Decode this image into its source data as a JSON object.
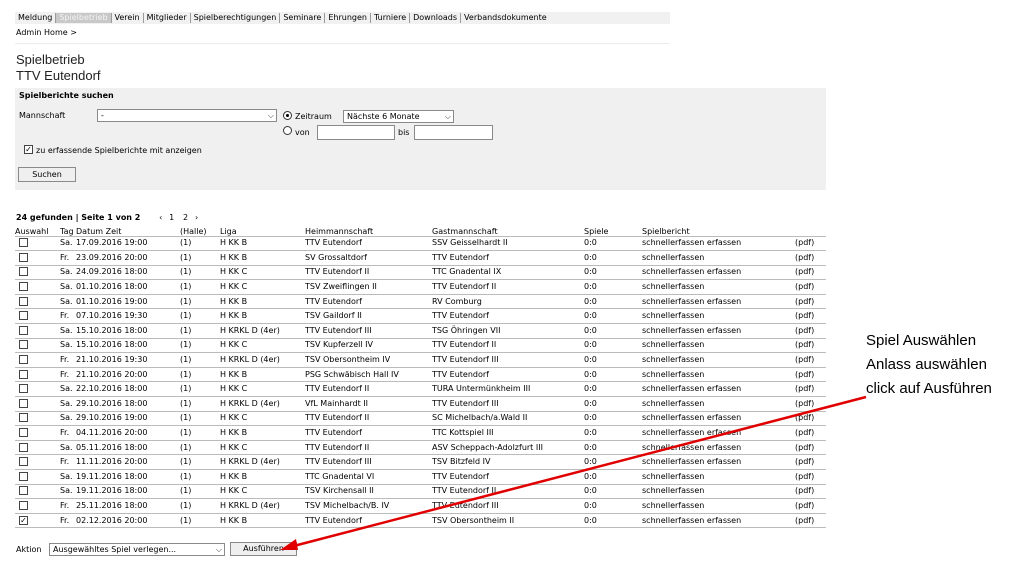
{
  "nav": {
    "items": [
      {
        "label": "Meldung",
        "active": false
      },
      {
        "label": "Spielbetrieb",
        "active": true
      },
      {
        "label": "Verein",
        "active": false
      },
      {
        "label": "Mitglieder",
        "active": false
      },
      {
        "label": "Spielberechtigungen",
        "active": false
      },
      {
        "label": "Seminare",
        "active": false
      },
      {
        "label": "Ehrungen",
        "active": false
      },
      {
        "label": "Turniere",
        "active": false
      },
      {
        "label": "Downloads",
        "active": false
      },
      {
        "label": "Verbandsdokumente",
        "active": false
      }
    ]
  },
  "breadcrumb": "Admin Home >",
  "page": {
    "title": "Spielbetrieb",
    "subtitle": "TTV Eutendorf"
  },
  "search": {
    "title": "Spielberichte suchen",
    "mannschaft_label": "Mannschaft",
    "mannschaft_value": "-",
    "zeitraum_label": "Zeitraum",
    "zeitraum_value": "Nächste 6 Monate",
    "von_label": "von",
    "bis_label": "bis",
    "von_value": "",
    "bis_value": "",
    "checkbox_label": "zu erfassende Spielberichte mit anzeigen",
    "checkbox_checked": true,
    "submit_label": "Suchen"
  },
  "results": {
    "found_text": "24 gefunden | Seite 1 von 2",
    "prev": "‹",
    "page1": "1",
    "page2": "2",
    "next": "›",
    "columns": {
      "auswahl": "Auswahl",
      "tag": "Tag",
      "datum_zeit": "Datum Zeit",
      "halle": "(Halle)",
      "liga": "Liga",
      "heim": "Heimmannschaft",
      "gast": "Gastmannschaft",
      "spiele": "Spiele",
      "spielbericht": "Spielbericht",
      "pdf": ""
    },
    "rows": [
      {
        "checked": false,
        "tag": "Sa.",
        "datum": "17.09.2016 19:00",
        "halle": "(1)",
        "liga": "H KK B",
        "heim": "TTV Eutendorf",
        "gast": "SSV Geisselhardt II",
        "spiele": "0:0",
        "schnell": "schnellerfassen",
        "erfassen": "erfassen",
        "pdf": "(pdf)"
      },
      {
        "checked": false,
        "tag": "Fr.",
        "datum": "23.09.2016 20:00",
        "halle": "(1)",
        "liga": "H KK B",
        "heim": "SV Grossaltdorf",
        "gast": "TTV Eutendorf",
        "spiele": "0:0",
        "schnell": "schnellerfassen",
        "erfassen": "",
        "pdf": "(pdf)"
      },
      {
        "checked": false,
        "tag": "Sa.",
        "datum": "24.09.2016 18:00",
        "halle": "(1)",
        "liga": "H KK C",
        "heim": "TTV Eutendorf II",
        "gast": "TTC Gnadental IX",
        "spiele": "0:0",
        "schnell": "schnellerfassen",
        "erfassen": "erfassen",
        "pdf": "(pdf)"
      },
      {
        "checked": false,
        "tag": "Sa.",
        "datum": "01.10.2016 18:00",
        "halle": "(1)",
        "liga": "H KK C",
        "heim": "TSV Zweiflingen II",
        "gast": "TTV Eutendorf II",
        "spiele": "0:0",
        "schnell": "schnellerfassen",
        "erfassen": "",
        "pdf": "(pdf)"
      },
      {
        "checked": false,
        "tag": "Sa.",
        "datum": "01.10.2016 19:00",
        "halle": "(1)",
        "liga": "H KK B",
        "heim": "TTV Eutendorf",
        "gast": "RV Comburg",
        "spiele": "0:0",
        "schnell": "schnellerfassen",
        "erfassen": "erfassen",
        "pdf": "(pdf)"
      },
      {
        "checked": false,
        "tag": "Fr.",
        "datum": "07.10.2016 19:30",
        "halle": "(1)",
        "liga": "H KK B",
        "heim": "TSV Gaildorf II",
        "gast": "TTV Eutendorf",
        "spiele": "0:0",
        "schnell": "schnellerfassen",
        "erfassen": "",
        "pdf": "(pdf)"
      },
      {
        "checked": false,
        "tag": "Sa.",
        "datum": "15.10.2016 18:00",
        "halle": "(1)",
        "liga": "H KRKL D (4er)",
        "heim": "TTV Eutendorf III",
        "gast": "TSG Öhringen VII",
        "spiele": "0:0",
        "schnell": "schnellerfassen",
        "erfassen": "erfassen",
        "pdf": "(pdf)"
      },
      {
        "checked": false,
        "tag": "Sa.",
        "datum": "15.10.2016 18:00",
        "halle": "(1)",
        "liga": "H KK C",
        "heim": "TSV Kupferzell IV",
        "gast": "TTV Eutendorf II",
        "spiele": "0:0",
        "schnell": "schnellerfassen",
        "erfassen": "",
        "pdf": "(pdf)"
      },
      {
        "checked": false,
        "tag": "Fr.",
        "datum": "21.10.2016 19:30",
        "halle": "(1)",
        "liga": "H KRKL D (4er)",
        "heim": "TSV Obersontheim IV",
        "gast": "TTV Eutendorf III",
        "spiele": "0:0",
        "schnell": "schnellerfassen",
        "erfassen": "",
        "pdf": "(pdf)"
      },
      {
        "checked": false,
        "tag": "Fr.",
        "datum": "21.10.2016 20:00",
        "halle": "(1)",
        "liga": "H KK B",
        "heim": "PSG Schwäbisch Hall IV",
        "gast": "TTV Eutendorf",
        "spiele": "0:0",
        "schnell": "schnellerfassen",
        "erfassen": "",
        "pdf": "(pdf)"
      },
      {
        "checked": false,
        "tag": "Sa.",
        "datum": "22.10.2016 18:00",
        "halle": "(1)",
        "liga": "H KK C",
        "heim": "TTV Eutendorf II",
        "gast": "TURA Untermünkheim III",
        "spiele": "0:0",
        "schnell": "schnellerfassen",
        "erfassen": "erfassen",
        "pdf": "(pdf)"
      },
      {
        "checked": false,
        "tag": "Sa.",
        "datum": "29.10.2016 18:00",
        "halle": "(1)",
        "liga": "H KRKL D (4er)",
        "heim": "VfL Mainhardt II",
        "gast": "TTV Eutendorf III",
        "spiele": "0:0",
        "schnell": "schnellerfassen",
        "erfassen": "",
        "pdf": "(pdf)"
      },
      {
        "checked": false,
        "tag": "Sa.",
        "datum": "29.10.2016 19:00",
        "halle": "(1)",
        "liga": "H KK C",
        "heim": "TTV Eutendorf II",
        "gast": "SC Michelbach/a.Wald II",
        "spiele": "0:0",
        "schnell": "schnellerfassen",
        "erfassen": "erfassen",
        "pdf": "(pdf)"
      },
      {
        "checked": false,
        "tag": "Fr.",
        "datum": "04.11.2016 20:00",
        "halle": "(1)",
        "liga": "H KK B",
        "heim": "TTV Eutendorf",
        "gast": "TTC Kottspiel III",
        "spiele": "0:0",
        "schnell": "schnellerfassen",
        "erfassen": "erfassen",
        "pdf": "(pdf)"
      },
      {
        "checked": false,
        "tag": "Sa.",
        "datum": "05.11.2016 18:00",
        "halle": "(1)",
        "liga": "H KK C",
        "heim": "TTV Eutendorf II",
        "gast": "ASV Scheppach-Adolzfurt III",
        "spiele": "0:0",
        "schnell": "schnellerfassen",
        "erfassen": "erfassen",
        "pdf": "(pdf)"
      },
      {
        "checked": false,
        "tag": "Fr.",
        "datum": "11.11.2016 20:00",
        "halle": "(1)",
        "liga": "H KRKL D (4er)",
        "heim": "TTV Eutendorf III",
        "gast": "TSV Bitzfeld IV",
        "spiele": "0:0",
        "schnell": "schnellerfassen",
        "erfassen": "erfassen",
        "pdf": "(pdf)"
      },
      {
        "checked": false,
        "tag": "Sa.",
        "datum": "19.11.2016 18:00",
        "halle": "(1)",
        "liga": "H KK B",
        "heim": "TTC Gnadental VI",
        "gast": "TTV Eutendorf",
        "spiele": "0:0",
        "schnell": "schnellerfassen",
        "erfassen": "",
        "pdf": "(pdf)"
      },
      {
        "checked": false,
        "tag": "Sa.",
        "datum": "19.11.2016 18:00",
        "halle": "(1)",
        "liga": "H KK C",
        "heim": "TSV Kirchensall II",
        "gast": "TTV Eutendorf II",
        "spiele": "0:0",
        "schnell": "schnellerfassen",
        "erfassen": "",
        "pdf": "(pdf)"
      },
      {
        "checked": false,
        "tag": "Fr.",
        "datum": "25.11.2016 18:00",
        "halle": "(1)",
        "liga": "H KRKL D (4er)",
        "heim": "TSV Michelbach/B. IV",
        "gast": "TTV Eutendorf III",
        "spiele": "0:0",
        "schnell": "schnellerfassen",
        "erfassen": "",
        "pdf": "(pdf)"
      },
      {
        "checked": true,
        "tag": "Fr.",
        "datum": "02.12.2016 20:00",
        "halle": "(1)",
        "liga": "H KK B",
        "heim": "TTV Eutendorf",
        "gast": "TSV Obersontheim II",
        "spiele": "0:0",
        "schnell": "schnellerfassen",
        "erfassen": "erfassen",
        "pdf": "(pdf)"
      }
    ]
  },
  "aktion": {
    "label": "Aktion",
    "select_value": "Ausgewähltes Spiel verlegen...",
    "button_label": "Ausführen"
  },
  "annotation": {
    "line1": "Spiel Auswählen",
    "line2": "Anlass auswählen",
    "line3": "click auf Ausführen"
  },
  "colors": {
    "arrow": "#e00000",
    "panel": "#f0f0f0"
  },
  "icons": {
    "dropdown": "chevron-down-icon",
    "check": "check-icon",
    "arrow": "arrow-icon"
  }
}
